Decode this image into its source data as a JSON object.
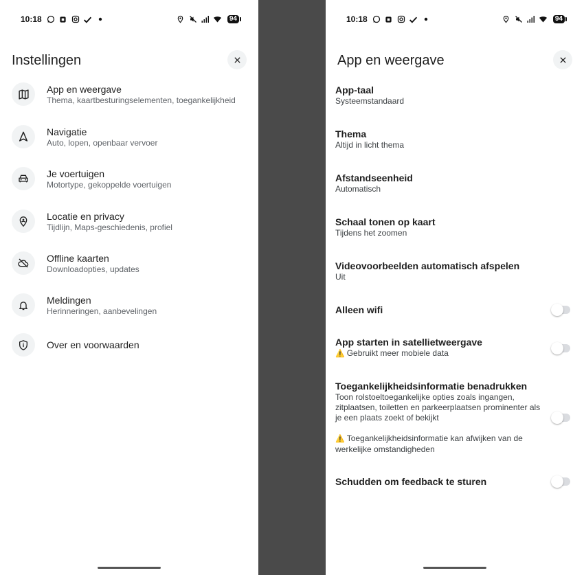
{
  "status_bar": {
    "time": "10:18",
    "battery": "94",
    "left_icons": [
      "whatsapp-icon",
      "app-icon",
      "instagram-icon",
      "check-icon",
      "dot-icon"
    ],
    "right_icons": [
      "location-icon",
      "mute-icon",
      "signal-icon",
      "wifi-icon"
    ]
  },
  "left_screen": {
    "title": "Instellingen",
    "items": [
      {
        "title": "App en weergave",
        "subtitle": "Thema, kaartbesturingselementen, toegankelijkheid",
        "icon": "map-icon"
      },
      {
        "title": "Navigatie",
        "subtitle": "Auto, lopen, openbaar vervoer",
        "icon": "navigation-icon"
      },
      {
        "title": "Je voertuigen",
        "subtitle": "Motortype, gekoppelde voertuigen",
        "icon": "car-icon"
      },
      {
        "title": "Locatie en privacy",
        "subtitle": "Tijdlijn, Maps-geschiedenis, profiel",
        "icon": "location-privacy-icon"
      },
      {
        "title": "Offline kaarten",
        "subtitle": "Downloadopties, updates",
        "icon": "cloud-off-icon"
      },
      {
        "title": "Meldingen",
        "subtitle": "Herinneringen, aanbevelingen",
        "icon": "bell-icon"
      },
      {
        "title": "Over en voorwaarden",
        "subtitle": "",
        "icon": "shield-info-icon"
      }
    ]
  },
  "right_screen": {
    "title": "App en weergave",
    "items": [
      {
        "title": "App-taal",
        "subtitle": "Systeemstandaard"
      },
      {
        "title": "Thema",
        "subtitle": "Altijd in licht thema"
      },
      {
        "title": "Afstandseenheid",
        "subtitle": "Automatisch"
      },
      {
        "title": "Schaal tonen op kaart",
        "subtitle": "Tijdens het zoomen"
      },
      {
        "title": "Videovoorbeelden automatisch afspelen",
        "subtitle": "Uit"
      }
    ],
    "toggles": [
      {
        "title": "Alleen wifi",
        "subtitle": "",
        "on": false
      },
      {
        "title": "App starten in satellietweergave",
        "subtitle": "Gebruikt meer mobiele data",
        "warn": true,
        "on": false
      },
      {
        "title": "Toegankelijkheidsinformatie benadrukken",
        "subtitle": "Toon rolstoeltoegankelijke opties zoals ingangen, zitplaatsen, toiletten en parkeerplaatsen prominenter als je een plaats zoekt of bekijkt",
        "warning": "Toegankelijkheidsinformatie kan afwijken van de werkelijke omstandigheden",
        "on": false
      },
      {
        "title": "Schudden om feedback te sturen",
        "subtitle": "",
        "on": false
      }
    ]
  },
  "colors": {
    "background_divider": "#4a4a4a",
    "panel": "#ffffff",
    "icon_bg": "#f1f3f4",
    "toggle_track": "#dadce0"
  }
}
